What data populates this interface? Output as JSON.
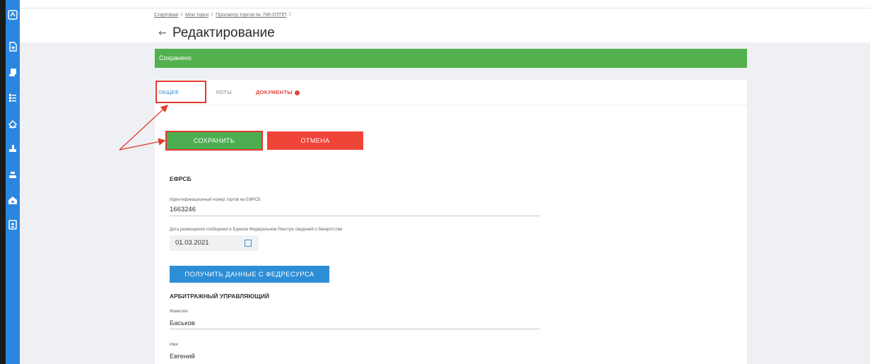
{
  "sidebar": {
    "icons": [
      "logo-icon",
      "document-plus-icon",
      "scroll-icon",
      "list-icon",
      "handshake-icon",
      "gavel-icon",
      "gavel-alt-icon",
      "home-lock-icon",
      "contacts-icon"
    ]
  },
  "breadcrumb": {
    "items": [
      "Стартовая",
      "Мои торги",
      "Просмотр торгов № 796-ОТПП"
    ],
    "separator": "/"
  },
  "header": {
    "back_glyph": "←",
    "title": "Редактирование"
  },
  "banner": {
    "text": "Сохранено",
    "color": "#53b04e"
  },
  "tabs": {
    "general": "ОБЩЕЕ",
    "lots": "ЛОТЫ",
    "documents": "ДОКУМЕНТЫ"
  },
  "actions": {
    "save_label": "СОХРАНИТЬ",
    "cancel_label": "ОТМЕНА"
  },
  "efrsb": {
    "section_title": "ЕФРСБ",
    "id_label": "Идентификационный номер торгов на ЕФРСБ",
    "id_value": "1663246",
    "date_label": "Дата размещения сообщения в Едином Федеральном Реестре сведений о банкротстве",
    "date_value": "01.03.2021",
    "fetch_button": "ПОЛУЧИТЬ ДАННЫЕ С ФЕДРЕСУРСА"
  },
  "manager": {
    "section_title": "АРБИТРАЖНЫЙ УПРАВЛЯЮЩИЙ",
    "surname_label": "Фамилия",
    "surname_value": "Баськов",
    "name_label": "Имя",
    "name_value": "Евгений"
  },
  "colors": {
    "accent": "#2b86e0",
    "success": "#53b04e",
    "danger": "#ef4438",
    "annotation": "#e23b2d"
  }
}
